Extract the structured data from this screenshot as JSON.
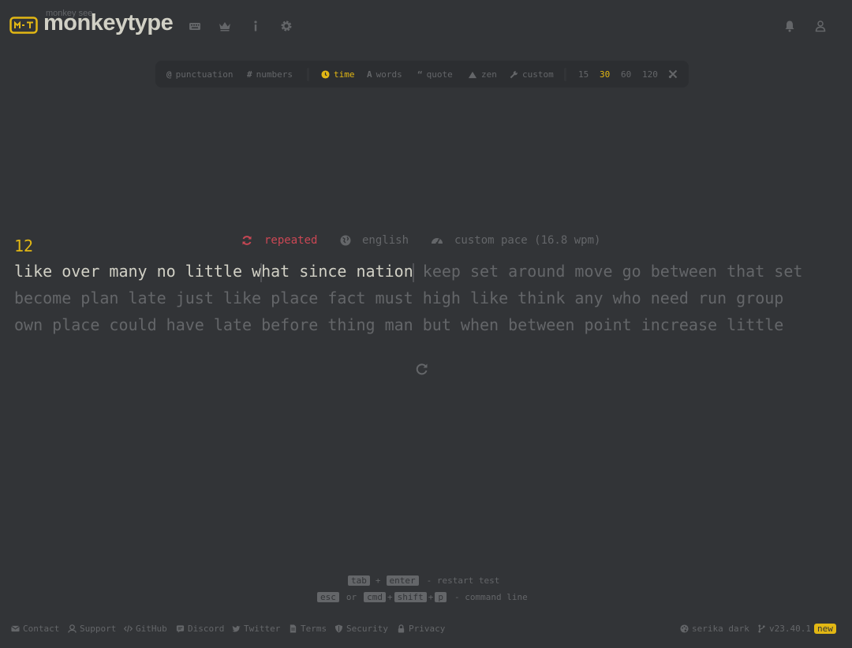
{
  "header": {
    "logo_small": "monkey see",
    "logo_text": "monkeytype",
    "nav_icons": [
      "keyboard-icon",
      "crown-icon",
      "info-icon",
      "gear-icon",
      "bell-icon",
      "user-icon"
    ]
  },
  "config": {
    "punctuation": "punctuation",
    "numbers": "numbers",
    "time": "time",
    "words": "words",
    "quote": "quote",
    "zen": "zen",
    "custom": "custom",
    "durations": [
      "15",
      "30",
      "60",
      "120"
    ],
    "active_mode": "time",
    "active_duration": "30"
  },
  "test": {
    "timer": "12",
    "repeated_label": "repeated",
    "language_label": "english",
    "pace_label": "custom pace (16.8 wpm)",
    "line1_done_a": "like over many no little w",
    "line1_done_b": "hat since nation",
    "line1_todo": " keep set around move go between that set",
    "line2": "become plan late just like place fact must high like think any who need run group",
    "line3": "own place could have late before thing man but when between point increase little"
  },
  "hints": {
    "tab": "tab",
    "enter": "enter",
    "restart_text": "- restart test",
    "esc": "esc",
    "or": "or",
    "cmd": "cmd",
    "shift": "shift",
    "p": "p",
    "command_text": "- command line"
  },
  "footer": {
    "contact": "Contact",
    "support": "Support",
    "github": "GitHub",
    "discord": "Discord",
    "twitter": "Twitter",
    "terms": "Terms",
    "security": "Security",
    "privacy": "Privacy",
    "theme": "serika dark",
    "version": "v23.40.1",
    "new_badge": "new"
  },
  "colors": {
    "background": "#323437",
    "accent": "#e2b714",
    "sub": "#646669",
    "text": "#d1d0c5",
    "error": "#ca4754"
  }
}
